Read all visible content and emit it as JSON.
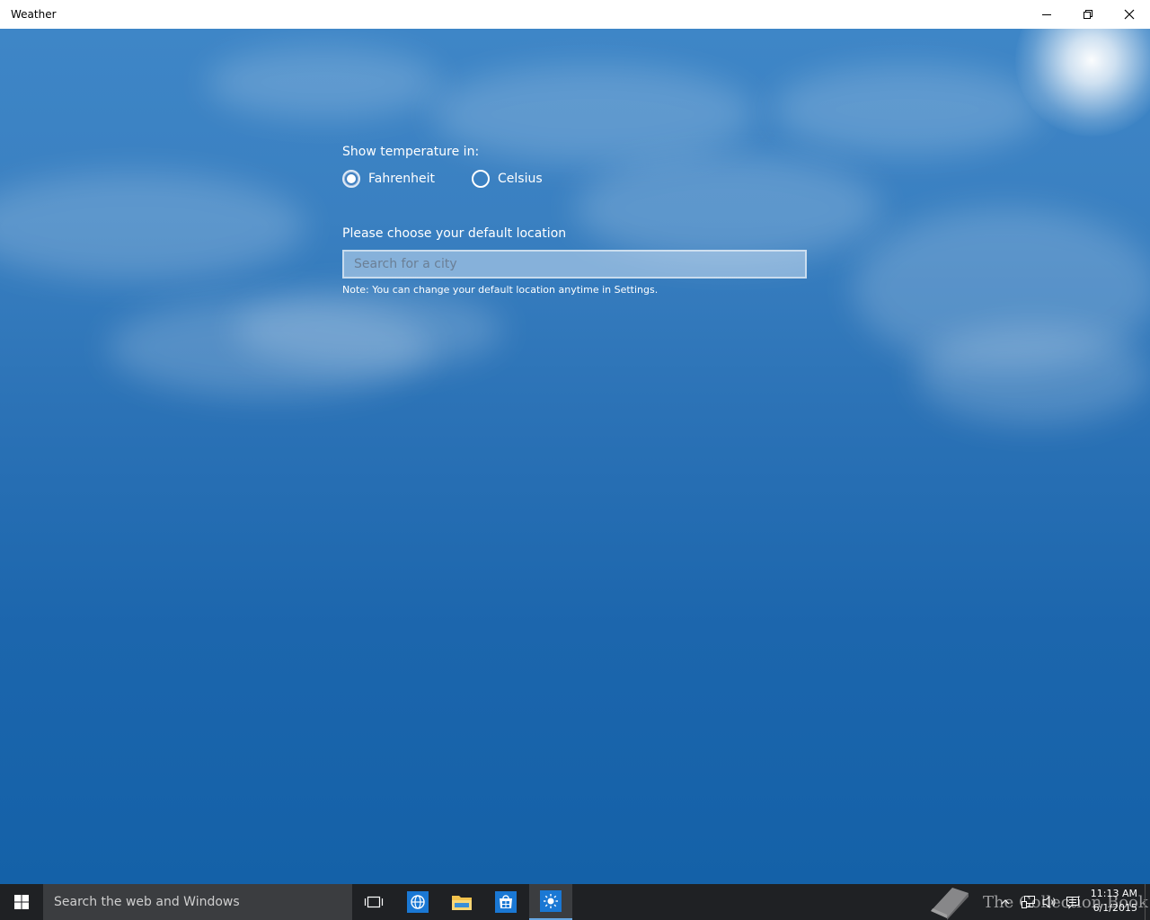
{
  "window": {
    "title": "Weather"
  },
  "settings": {
    "temperature_label": "Show temperature in:",
    "options": [
      {
        "label": "Fahrenheit",
        "selected": true
      },
      {
        "label": "Celsius",
        "selected": false
      }
    ],
    "location_label": "Please choose your default location",
    "search_placeholder": "Search for a city",
    "search_value": "",
    "note": "Note: You can change your default location anytime in Settings."
  },
  "taskbar": {
    "search_text": "Search the web and Windows",
    "apps": [
      {
        "icon": "task-view-icon"
      },
      {
        "icon": "edge-icon"
      },
      {
        "icon": "file-explorer-icon"
      },
      {
        "icon": "store-icon"
      },
      {
        "icon": "weather-app-icon",
        "active": true
      }
    ],
    "watermark": "The Collection Book",
    "clock_time": "11:13 AM",
    "clock_date": "6/1/2015"
  },
  "colors": {
    "sky_top": "#3e86c7",
    "sky_bottom": "#1461a8",
    "taskbar": "#1f2124",
    "accent": "#66a6e0"
  }
}
